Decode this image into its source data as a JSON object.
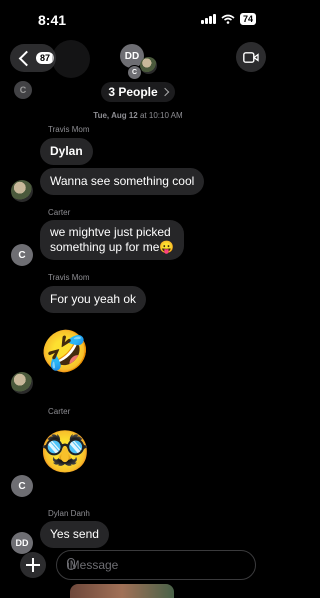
{
  "status_bar": {
    "time": "8:41",
    "battery": "74"
  },
  "header": {
    "back_count": "87",
    "group_initials": "DD",
    "group_member_initial": "C",
    "group_name": "3 People",
    "top_avatar_initial": "C"
  },
  "timestamp": {
    "day": "Tue, Aug 12",
    "time": "at 10:10 AM"
  },
  "messages": [
    {
      "sender": "Travis Mom",
      "text": "Dylan"
    },
    {
      "text": "Wanna see something cool"
    },
    {
      "sender": "Carter",
      "text_line1": "we mightve just picked",
      "text_line2": "something up for me😛",
      "avatar": "C"
    },
    {
      "sender": "Travis Mom",
      "text": "For you yeah ok"
    },
    {
      "emoji": "🤣"
    },
    {
      "sender": "Carter",
      "emoji": "🥸",
      "avatar": "C"
    },
    {
      "sender": "Dylan Danh",
      "text": "Yes send",
      "avatar": "DD"
    }
  ],
  "composer": {
    "placeholder": "iMessage"
  },
  "colors": {
    "bubble": "#262628",
    "background": "#000000",
    "muted": "#8e8e93"
  }
}
